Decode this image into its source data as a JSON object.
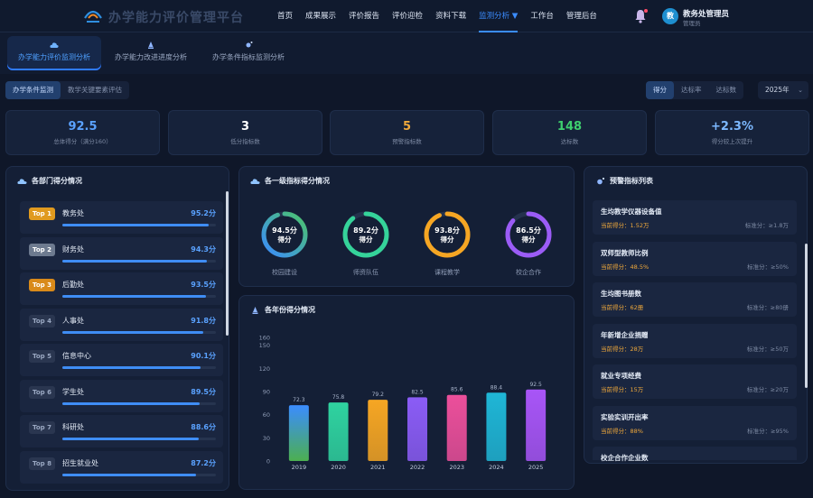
{
  "app": {
    "title": "办学能力评价管理平台"
  },
  "nav": {
    "items": [
      "首页",
      "成果展示",
      "评价报告",
      "评价迎检",
      "资料下载",
      "监测分析 ▼",
      "工作台",
      "管理后台"
    ],
    "active": 5
  },
  "user": {
    "name": "教务处管理员",
    "role": "管理员",
    "avatar": "教"
  },
  "subtabs": [
    "办学能力评价监测分析",
    "办学能力改进进度分析",
    "办学条件指标监测分析"
  ],
  "left_segment": [
    "办学条件监测",
    "教学关键要素评估"
  ],
  "metric_segment": [
    "得分",
    "达标率",
    "达标数"
  ],
  "year": "2025年",
  "kpis": [
    {
      "value": "92.5",
      "label": "总体得分（满分160）",
      "color": "#5aa2ff"
    },
    {
      "value": "3",
      "label": "低分指标数",
      "color": "#ffffff"
    },
    {
      "value": "5",
      "label": "预警指标数",
      "color": "#f0a93b"
    },
    {
      "value": "148",
      "label": "达标数",
      "color": "#3ecf6e"
    },
    {
      "value": "+2.3%",
      "label": "得分较上次提升",
      "color": "#7cb8ff"
    }
  ],
  "dept_panel": {
    "title": "各部门得分情况",
    "rows": [
      {
        "rank": "Top 1",
        "name": "教务处",
        "score": "95.2分",
        "pct": 0.952,
        "rank_color": "#e09a1f"
      },
      {
        "rank": "Top 2",
        "name": "财务处",
        "score": "94.3分",
        "pct": 0.943,
        "rank_color": "#6d7a8f"
      },
      {
        "rank": "Top 3",
        "name": "后勤处",
        "score": "93.5分",
        "pct": 0.935,
        "rank_color": "#d98a1a"
      },
      {
        "rank": "Top 4",
        "name": "人事处",
        "score": "91.8分",
        "pct": 0.918,
        "rank_color": "#2a3650"
      },
      {
        "rank": "Top 5",
        "name": "信息中心",
        "score": "90.1分",
        "pct": 0.901,
        "rank_color": "#2a3650"
      },
      {
        "rank": "Top 6",
        "name": "学生处",
        "score": "89.5分",
        "pct": 0.895,
        "rank_color": "#2a3650"
      },
      {
        "rank": "Top 7",
        "name": "科研处",
        "score": "88.6分",
        "pct": 0.886,
        "rank_color": "#2a3650"
      },
      {
        "rank": "Top 8",
        "name": "招生就业处",
        "score": "87.2分",
        "pct": 0.872,
        "rank_color": "#2a3650"
      }
    ]
  },
  "gauge_panel": {
    "title": "各一级指标得分情况",
    "items": [
      {
        "value_text": "94.5分",
        "sub": "得分",
        "label": "校园建设",
        "pct": 0.945,
        "c1": "#3b8cff",
        "c2": "#4cc46a"
      },
      {
        "value_text": "89.2分",
        "sub": "得分",
        "label": "师资队伍",
        "pct": 0.892,
        "c1": "#35d39a",
        "c2": "#35d39a"
      },
      {
        "value_text": "93.8分",
        "sub": "得分",
        "label": "课程教学",
        "pct": 0.938,
        "c1": "#f6a623",
        "c2": "#f6a623"
      },
      {
        "value_text": "86.5分",
        "sub": "得分",
        "label": "校企合作",
        "pct": 0.865,
        "c1": "#9b5cf6",
        "c2": "#9b5cf6"
      }
    ]
  },
  "chart_data": {
    "type": "bar",
    "title": "各年份得分情况",
    "categories": [
      "2019",
      "2020",
      "2021",
      "2022",
      "2023",
      "2024",
      "2025"
    ],
    "values": [
      72.3,
      75.8,
      79.2,
      82.5,
      85.6,
      88.4,
      92.5
    ],
    "colors": [
      "#3b8cff",
      "#2fd3a0",
      "#f6a623",
      "#8b5cf6",
      "#ec4f9b",
      "#1fb6d6",
      "#a855f7"
    ],
    "ylim": [
      0,
      160
    ],
    "yticks": [
      0,
      30,
      60,
      90,
      120,
      150,
      160
    ],
    "xlabel": "",
    "ylabel": "",
    "grid": false
  },
  "warn_panel": {
    "title": "预警指标列表",
    "items": [
      {
        "name": "生均教学仪器设备值",
        "current": "当前得分：1.52万",
        "standard": "标准分：≥1.8万"
      },
      {
        "name": "双师型教师比例",
        "current": "当前得分：48.5%",
        "standard": "标准分：≥50%"
      },
      {
        "name": "生均图书册数",
        "current": "当前得分：62册",
        "standard": "标准分：≥80册"
      },
      {
        "name": "年新增企业捐赠",
        "current": "当前得分：28万",
        "standard": "标准分：≥50万"
      },
      {
        "name": "就业专项经费",
        "current": "当前得分：15万",
        "standard": "标准分：≥20万"
      },
      {
        "name": "实验实训开出率",
        "current": "当前得分：88%",
        "standard": "标准分：≥95%"
      },
      {
        "name": "校企合作企业数",
        "current": "",
        "standard": ""
      }
    ]
  }
}
